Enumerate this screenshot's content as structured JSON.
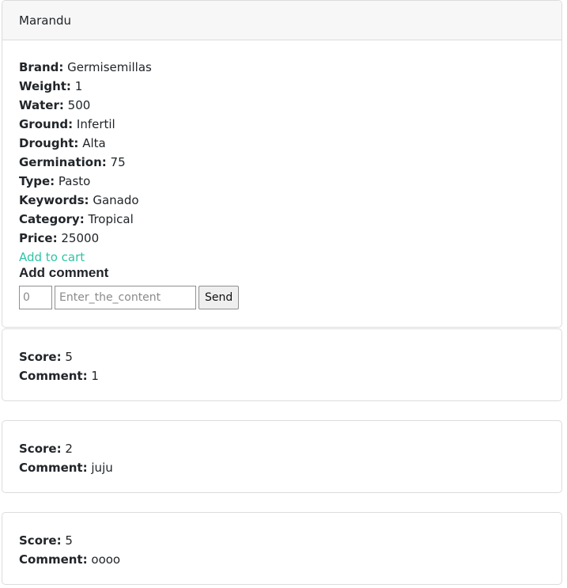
{
  "product": {
    "name": "Marandu",
    "fields": [
      {
        "label": "Brand:",
        "value": "Germisemillas"
      },
      {
        "label": "Weight:",
        "value": "1"
      },
      {
        "label": "Water:",
        "value": "500"
      },
      {
        "label": "Ground:",
        "value": "Infertil"
      },
      {
        "label": "Drought:",
        "value": "Alta"
      },
      {
        "label": "Germination:",
        "value": "75"
      },
      {
        "label": "Type:",
        "value": "Pasto"
      },
      {
        "label": "Keywords:",
        "value": "Ganado"
      },
      {
        "label": "Category:",
        "value": "Tropical"
      },
      {
        "label": "Price:",
        "value": "25000"
      }
    ],
    "add_to_cart_label": "Add to cart"
  },
  "comment_form": {
    "title": "Add comment",
    "score_placeholder": "0",
    "content_placeholder": "Enter_the_content",
    "send_label": "Send"
  },
  "comments": [
    {
      "score_label": "Score:",
      "score": "5",
      "comment_label": "Comment:",
      "comment": "1"
    },
    {
      "score_label": "Score:",
      "score": "2",
      "comment_label": "Comment:",
      "comment": "juju"
    },
    {
      "score_label": "Score:",
      "score": "5",
      "comment_label": "Comment:",
      "comment": "oooo"
    }
  ],
  "colors": {
    "link": "#2ec4a6",
    "header_bg": "#f7f7f7",
    "border": "#dcdcdc"
  }
}
